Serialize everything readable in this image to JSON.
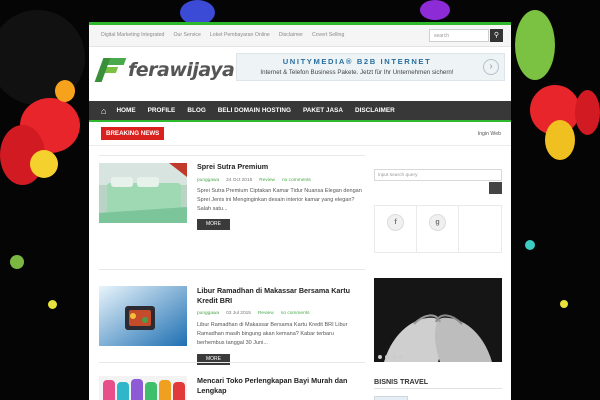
{
  "colors": {
    "accent": "#2eb82e",
    "nav_bg": "#383838",
    "breaking": "#d9211e",
    "meta_green": "#4aa94a"
  },
  "top_links": [
    "Digital Marketing Integrated",
    "Our Service",
    "Loket Pembayaran Online",
    "Disclaimer",
    "Covert Selling"
  ],
  "top_search": {
    "placeholder": "search",
    "icon": "search-icon"
  },
  "logo": {
    "text": "ferawijaya",
    "icon": "logo-mark"
  },
  "ad": {
    "title": "UNITYMEDIA® B2B INTERNET",
    "subtitle": "Internet & Telefon Business Pakete. Jetzt für Ihr Unternehmen sichern!",
    "arrow_icon": "chevron-right-icon"
  },
  "nav": {
    "home_icon": "home-icon",
    "items": [
      "HOME",
      "PROFILE",
      "BLOG",
      "BELI DOMAIN HOSTING",
      "PAKET JASA",
      "DISCLAIMER"
    ]
  },
  "breaking": {
    "label": "BREAKING NEWS",
    "ticker": "Ingin Web"
  },
  "posts": [
    {
      "title": "Sprei Sutra Premium",
      "author": "punggawa",
      "date": "24 Oct 2015",
      "category": "Review",
      "comments": "no comments",
      "excerpt": "Sprei Sutra Premium  Ciptakan Kamar Tidur Nuansa Elegan dengan Sprei Jenis ini Menginginkan desain interior kamar yang elegan? Salah satu...",
      "more": "MORE"
    },
    {
      "title": "Libur Ramadhan di Makassar Bersama Kartu Kredit BRI",
      "author": "punggawa",
      "date": "03 Jul 2015",
      "category": "Review",
      "comments": "no comments",
      "excerpt": "Libur Ramadhan di Makassar Bersama Kartu Kredit BRI Libur Ramadhan masih bingung akan kemana? Kabar terbaru berhembus tanggal 30 Juni...",
      "more": "MORE"
    },
    {
      "title": "Mencari Toko Perlengkapan Bayi Murah dan Lengkap"
    }
  ],
  "sidebar": {
    "search_placeholder": "input search query",
    "social_icons": [
      "facebook-icon",
      "google-plus-icon",
      "empty"
    ],
    "heading": "BISNIS TRAVEL"
  }
}
